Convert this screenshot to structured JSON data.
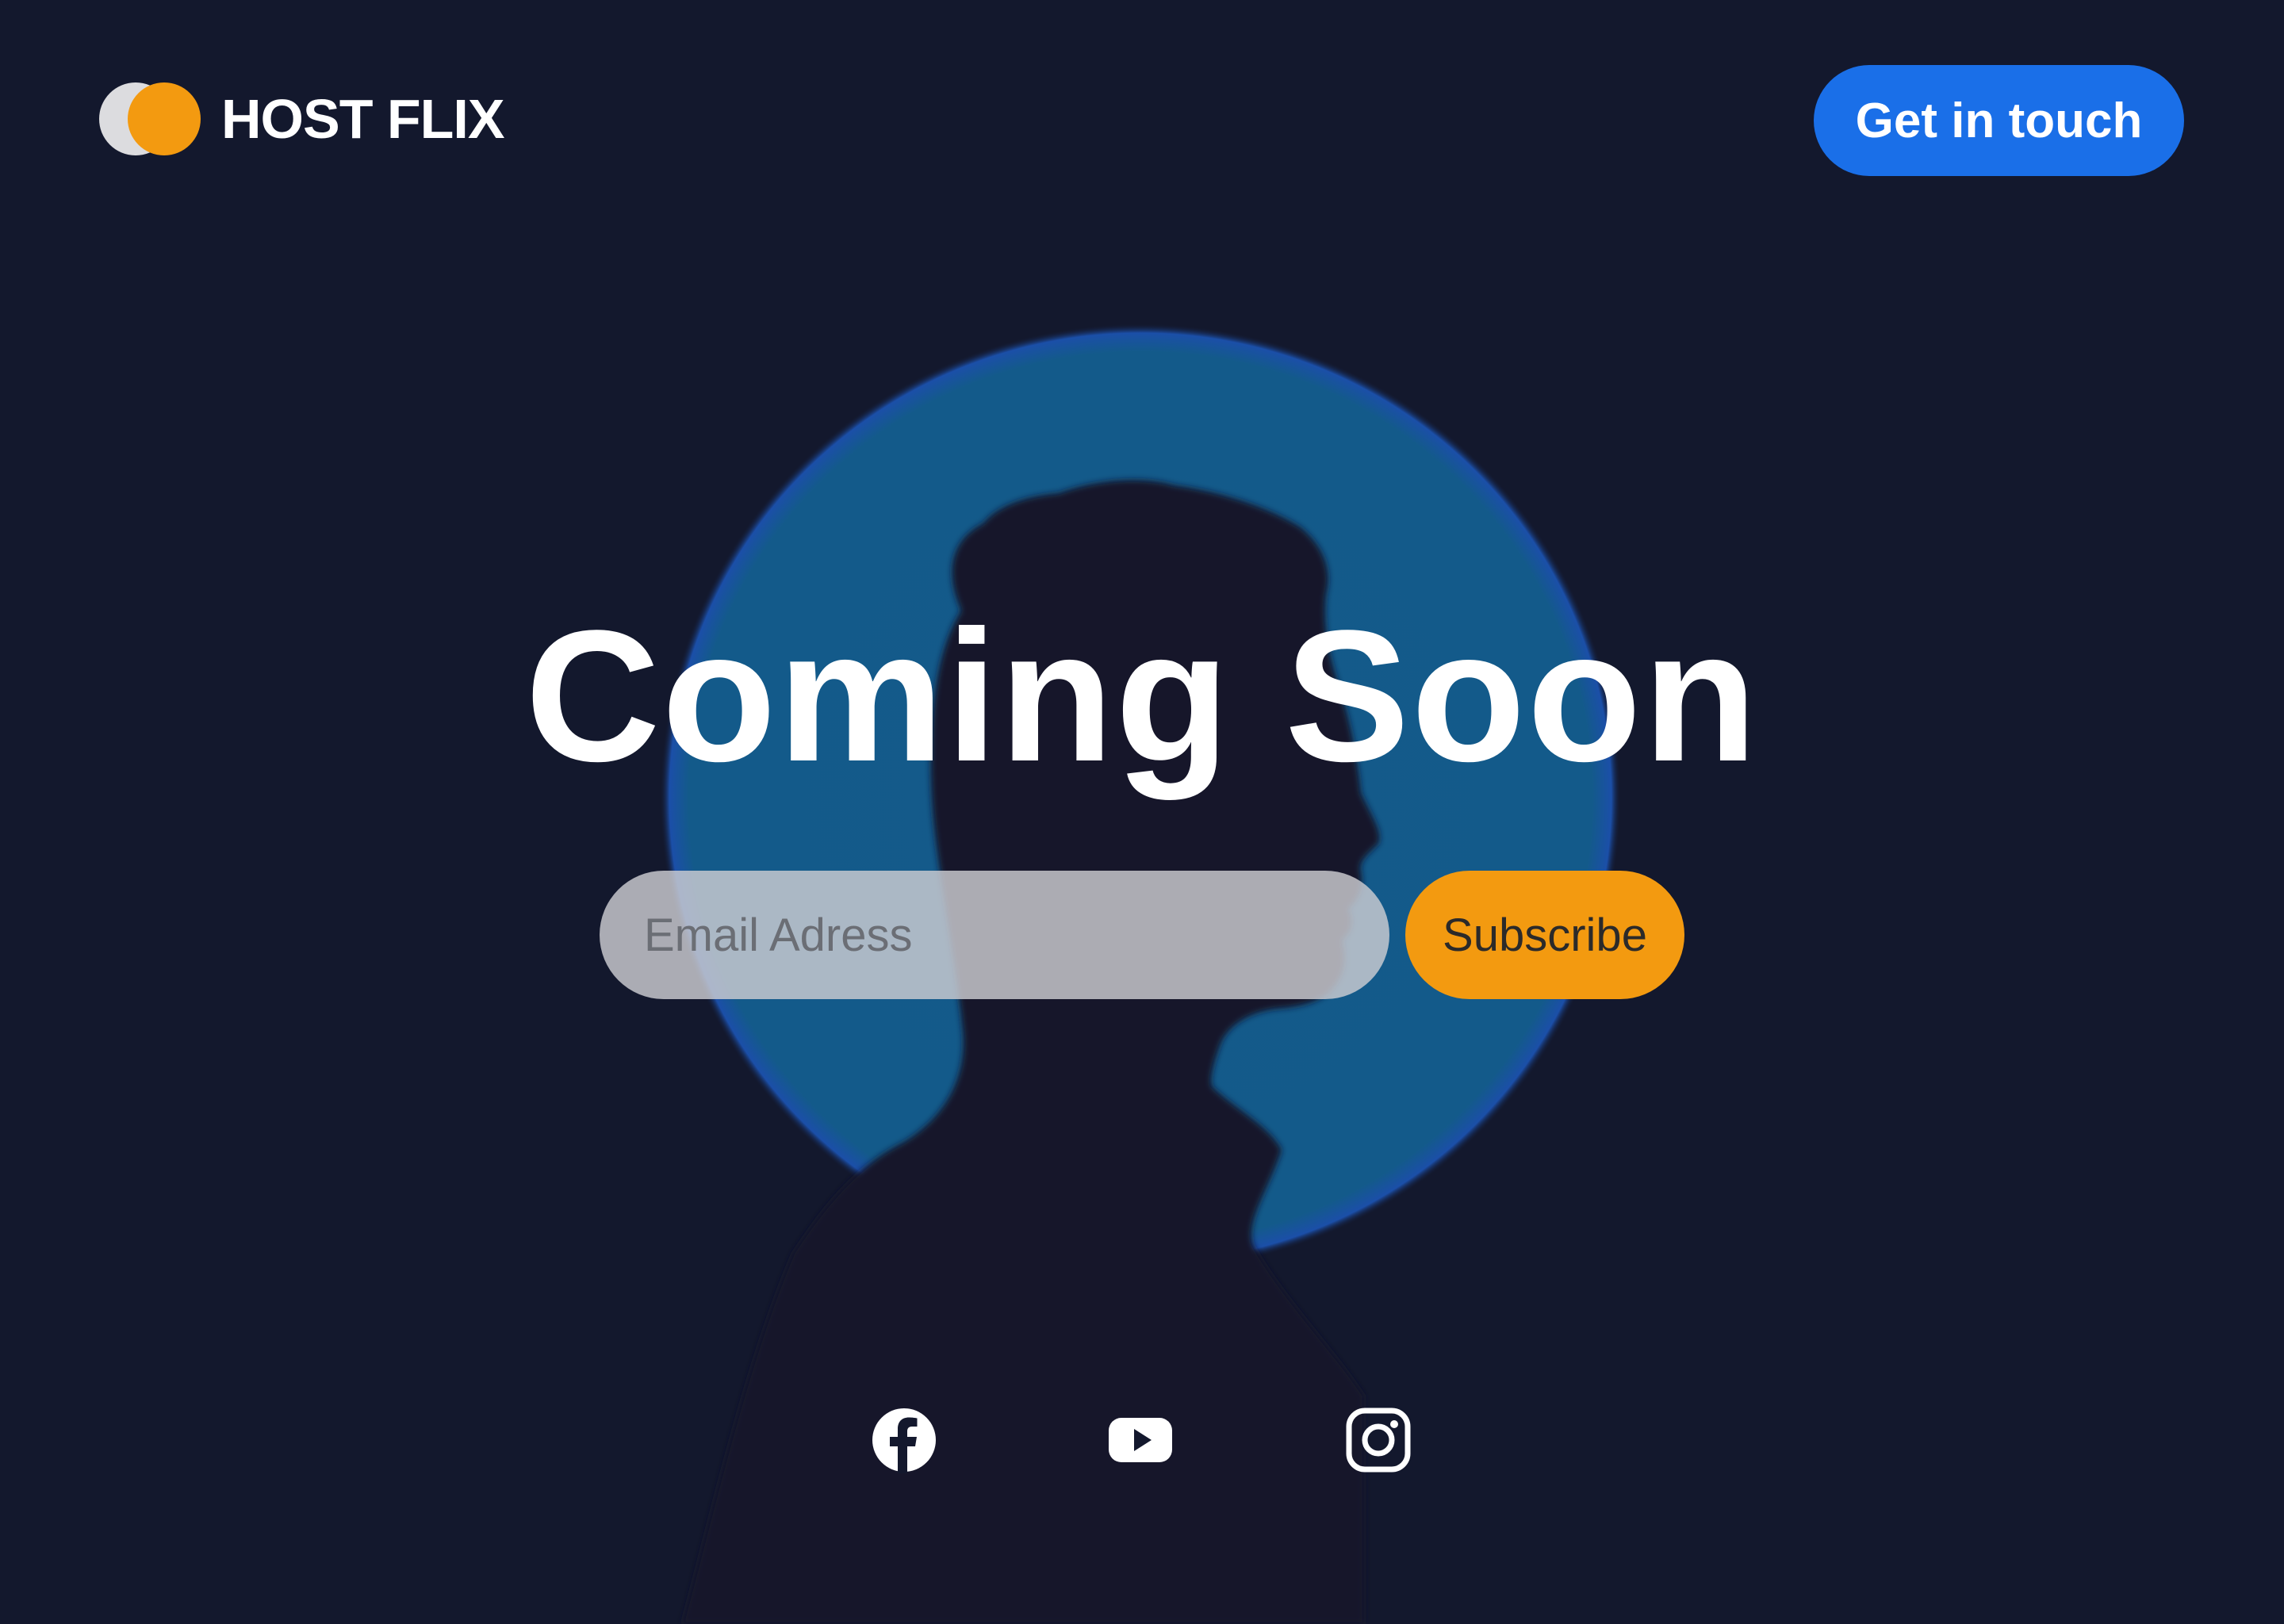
{
  "brand": {
    "name": "HOST FLIX",
    "logo_icon": "two-overlapping-circles-logo",
    "colors": {
      "background": "#13182d",
      "accent_orange": "#f39a10",
      "accent_blue": "#1a6fe8",
      "glow_blue": "#135a89"
    }
  },
  "header": {
    "cta_label": "Get in touch"
  },
  "hero": {
    "title": "Coming Soon",
    "image": "silhouette-of-person-in-front-of-blue-circle"
  },
  "subscribe": {
    "email_placeholder": "Email Adress",
    "email_value": "",
    "button_label": "Subscribe"
  },
  "social": [
    {
      "icon": "facebook-icon"
    },
    {
      "icon": "youtube-icon"
    },
    {
      "icon": "instagram-icon"
    }
  ]
}
